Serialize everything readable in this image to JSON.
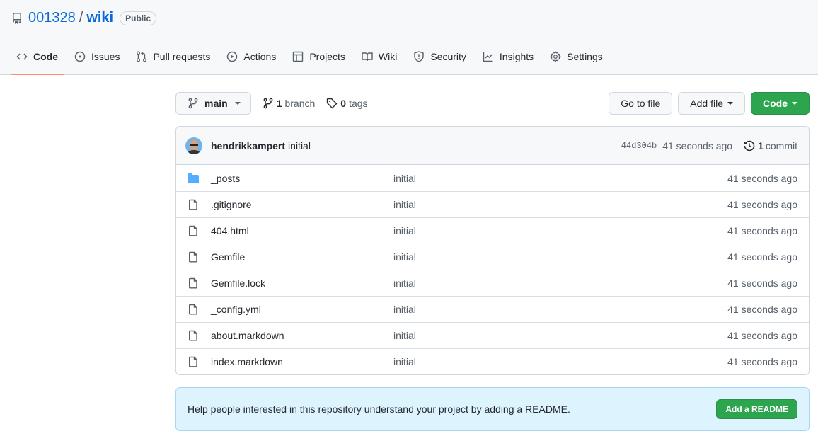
{
  "repo": {
    "owner": "001328",
    "separator": "/",
    "name": "wiki",
    "visibility": "Public"
  },
  "nav": {
    "tabs": [
      {
        "label": "Code",
        "icon": "code-icon",
        "active": true
      },
      {
        "label": "Issues",
        "icon": "issue-icon"
      },
      {
        "label": "Pull requests",
        "icon": "pull-request-icon"
      },
      {
        "label": "Actions",
        "icon": "play-icon"
      },
      {
        "label": "Projects",
        "icon": "table-icon"
      },
      {
        "label": "Wiki",
        "icon": "book-icon"
      },
      {
        "label": "Security",
        "icon": "shield-icon"
      },
      {
        "label": "Insights",
        "icon": "graph-icon"
      },
      {
        "label": "Settings",
        "icon": "gear-icon"
      }
    ]
  },
  "toolbar": {
    "branch": "main",
    "branch_count": "1",
    "branch_label": "branch",
    "tag_count": "0",
    "tag_label": "tags",
    "go_to_file": "Go to file",
    "add_file": "Add file",
    "code": "Code"
  },
  "commit": {
    "author": "hendrikkampert",
    "message": "initial",
    "sha": "44d304b",
    "time": "41 seconds ago",
    "count": "1",
    "count_label": "commit"
  },
  "files": [
    {
      "name": "_posts",
      "type": "dir",
      "message": "initial",
      "age": "41 seconds ago"
    },
    {
      "name": ".gitignore",
      "type": "file",
      "message": "initial",
      "age": "41 seconds ago"
    },
    {
      "name": "404.html",
      "type": "file",
      "message": "initial",
      "age": "41 seconds ago"
    },
    {
      "name": "Gemfile",
      "type": "file",
      "message": "initial",
      "age": "41 seconds ago"
    },
    {
      "name": "Gemfile.lock",
      "type": "file",
      "message": "initial",
      "age": "41 seconds ago"
    },
    {
      "name": "_config.yml",
      "type": "file",
      "message": "initial",
      "age": "41 seconds ago"
    },
    {
      "name": "about.markdown",
      "type": "file",
      "message": "initial",
      "age": "41 seconds ago"
    },
    {
      "name": "index.markdown",
      "type": "file",
      "message": "initial",
      "age": "41 seconds ago"
    }
  ],
  "readme": {
    "text": "Help people interested in this repository understand your project by adding a README.",
    "button": "Add a README"
  }
}
